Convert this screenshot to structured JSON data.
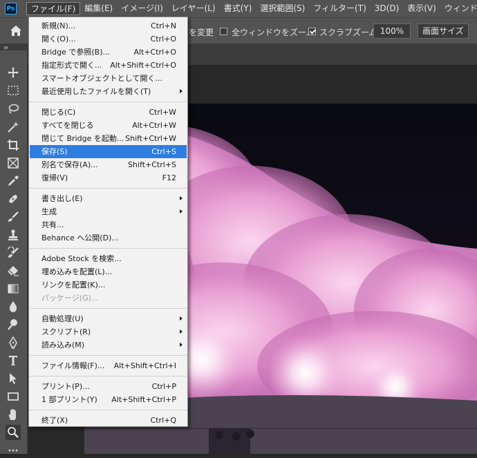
{
  "app": {
    "logo": "Ps"
  },
  "menubar": [
    {
      "label": "ファイル(F)",
      "active": true
    },
    {
      "label": "編集(E)"
    },
    {
      "label": "イメージ(I)"
    },
    {
      "label": "レイヤー(L)"
    },
    {
      "label": "書式(Y)"
    },
    {
      "label": "選択範囲(S)"
    },
    {
      "label": "フィルター(T)"
    },
    {
      "label": "3D(D)"
    },
    {
      "label": "表示(V)"
    },
    {
      "label": "ウィンドウ(W)"
    }
  ],
  "options": {
    "resize_windows_label_partial": "を変更",
    "zoom_all_windows_label": "全ウィンドウをズーム",
    "zoom_all_windows_checked": false,
    "scrubby_zoom_label": "スクラブズーム",
    "scrubby_zoom_checked": true,
    "zoom_value": "100%",
    "fit_screen_label": "画面サイズ"
  },
  "toolbar": {
    "tools": [
      "move-tool-icon",
      "marquee-tool-icon",
      "lasso-tool-icon",
      "magic-wand-tool-icon",
      "crop-tool-icon",
      "frame-tool-icon",
      "eyedropper-tool-icon",
      "healing-brush-tool-icon",
      "brush-tool-icon",
      "clone-stamp-tool-icon",
      "history-brush-tool-icon",
      "eraser-tool-icon",
      "gradient-tool-icon",
      "blur-tool-icon",
      "dodge-tool-icon",
      "pen-tool-icon",
      "type-tool-icon",
      "path-selection-tool-icon",
      "rectangle-tool-icon",
      "hand-tool-icon",
      "zoom-tool-icon",
      "more-tools-icon"
    ],
    "selected": "zoom-tool-icon"
  },
  "file_menu": {
    "groups": [
      [
        {
          "label": "新規(N)...",
          "shortcut": "Ctrl+N"
        },
        {
          "label": "開く(O)...",
          "shortcut": "Ctrl+O"
        },
        {
          "label": "Bridge で参照(B)...",
          "shortcut": "Alt+Ctrl+O"
        },
        {
          "label": "指定形式で開く...",
          "shortcut": "Alt+Shift+Ctrl+O"
        },
        {
          "label": "スマートオブジェクトとして開く...",
          "shortcut": ""
        },
        {
          "label": "最近使用したファイルを開く(T)",
          "shortcut": "",
          "submenu": true
        }
      ],
      [
        {
          "label": "閉じる(C)",
          "shortcut": "Ctrl+W"
        },
        {
          "label": "すべてを閉じる",
          "shortcut": "Alt+Ctrl+W"
        },
        {
          "label": "閉じて Bridge を起動...",
          "shortcut": "Shift+Ctrl+W"
        },
        {
          "label": "保存(S)",
          "shortcut": "Ctrl+S",
          "highlighted": true
        },
        {
          "label": "別名で保存(A)...",
          "shortcut": "Shift+Ctrl+S"
        },
        {
          "label": "復帰(V)",
          "shortcut": "F12"
        }
      ],
      [
        {
          "label": "書き出し(E)",
          "shortcut": "",
          "submenu": true
        },
        {
          "label": "生成",
          "shortcut": "",
          "submenu": true
        },
        {
          "label": "共有...",
          "shortcut": ""
        },
        {
          "label": "Behance へ公開(D)...",
          "shortcut": ""
        }
      ],
      [
        {
          "label": "Adobe Stock を検索...",
          "shortcut": ""
        },
        {
          "label": "埋め込みを配置(L)...",
          "shortcut": ""
        },
        {
          "label": "リンクを配置(K)...",
          "shortcut": ""
        },
        {
          "label": "パッケージ(G)...",
          "shortcut": "",
          "disabled": true
        }
      ],
      [
        {
          "label": "自動処理(U)",
          "shortcut": "",
          "submenu": true
        },
        {
          "label": "スクリプト(R)",
          "shortcut": "",
          "submenu": true
        },
        {
          "label": "読み込み(M)",
          "shortcut": "",
          "submenu": true
        }
      ],
      [
        {
          "label": "ファイル情報(F)...",
          "shortcut": "Alt+Shift+Ctrl+I"
        }
      ],
      [
        {
          "label": "プリント(P)...",
          "shortcut": "Ctrl+P"
        },
        {
          "label": "1 部プリント(Y)",
          "shortcut": "Alt+Shift+Ctrl+P"
        }
      ],
      [
        {
          "label": "終了(X)",
          "shortcut": "Ctrl+Q"
        }
      ]
    ]
  },
  "colors": {
    "highlight": "#2e7de0",
    "menubar": "#535353",
    "menu_bg": "#f2f2f2",
    "photo_blossom": "#f2b8e0"
  }
}
